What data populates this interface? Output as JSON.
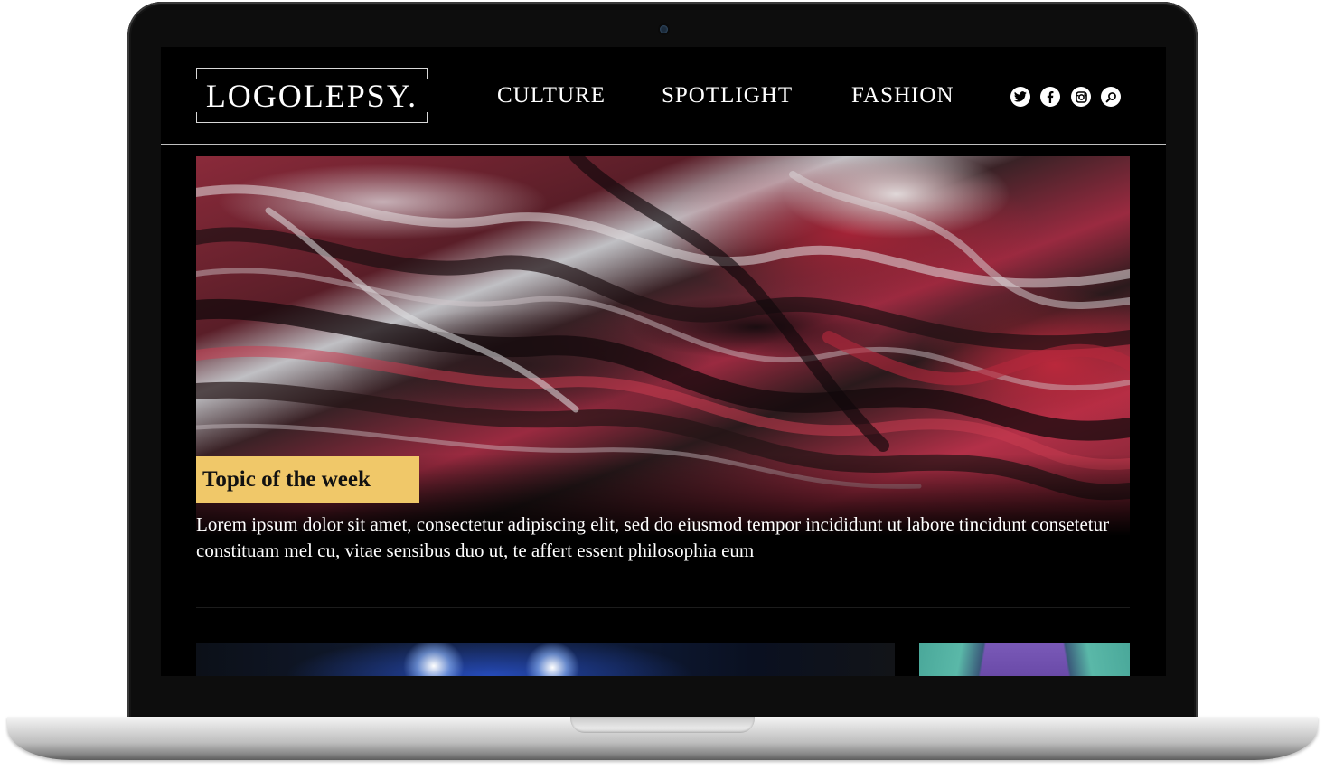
{
  "site": {
    "logo_text": "LOGOLEPSY."
  },
  "nav": {
    "items": [
      {
        "label": "CULTURE"
      },
      {
        "label": "SPOTLIGHT"
      },
      {
        "label": "FASHION"
      }
    ]
  },
  "social": {
    "icons": [
      "twitter-icon",
      "facebook-icon",
      "instagram-icon",
      "search-icon"
    ],
    "icon_color": "#ffffff"
  },
  "hero": {
    "tag_label": "Topic of the week",
    "description": "Lorem ipsum dolor sit amet, consectetur adipiscing elit, sed do eiusmod tempor incididunt ut labore tincidunt consetetur constituam mel cu, vitae sensibus duo ut, te affert essent philosophia eum"
  },
  "colors": {
    "background": "#000000",
    "accent_tag": "#f0c869",
    "text": "#ffffff"
  }
}
